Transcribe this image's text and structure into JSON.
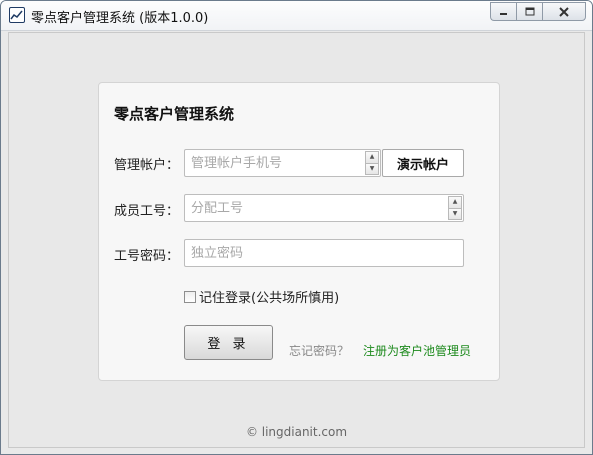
{
  "window": {
    "title": "零点客户管理系统 (版本1.0.0)",
    "icon": "chart-line-icon",
    "controls": {
      "minimize": "minimize-icon",
      "maximize": "maximize-icon",
      "close": "close-icon"
    }
  },
  "login": {
    "heading": "零点客户管理系统",
    "account_label": "管理帐户：",
    "account_placeholder": "管理帐户手机号",
    "demo_button": "演示帐户",
    "member_label": "成员工号：",
    "member_placeholder": "分配工号",
    "password_label": "工号密码：",
    "password_placeholder": "独立密码",
    "remember_label": "记住登录(公共场所慎用)",
    "remember_checked": false,
    "login_button": "登 录",
    "forgot_link": "忘记密码？",
    "register_link": "注册为客户池管理员"
  },
  "footer": {
    "copyright": "© lingdianit.com"
  },
  "colors": {
    "register_link": "#1d8a1d",
    "forgot_link": "#888888",
    "background": "#e8e8e8"
  }
}
